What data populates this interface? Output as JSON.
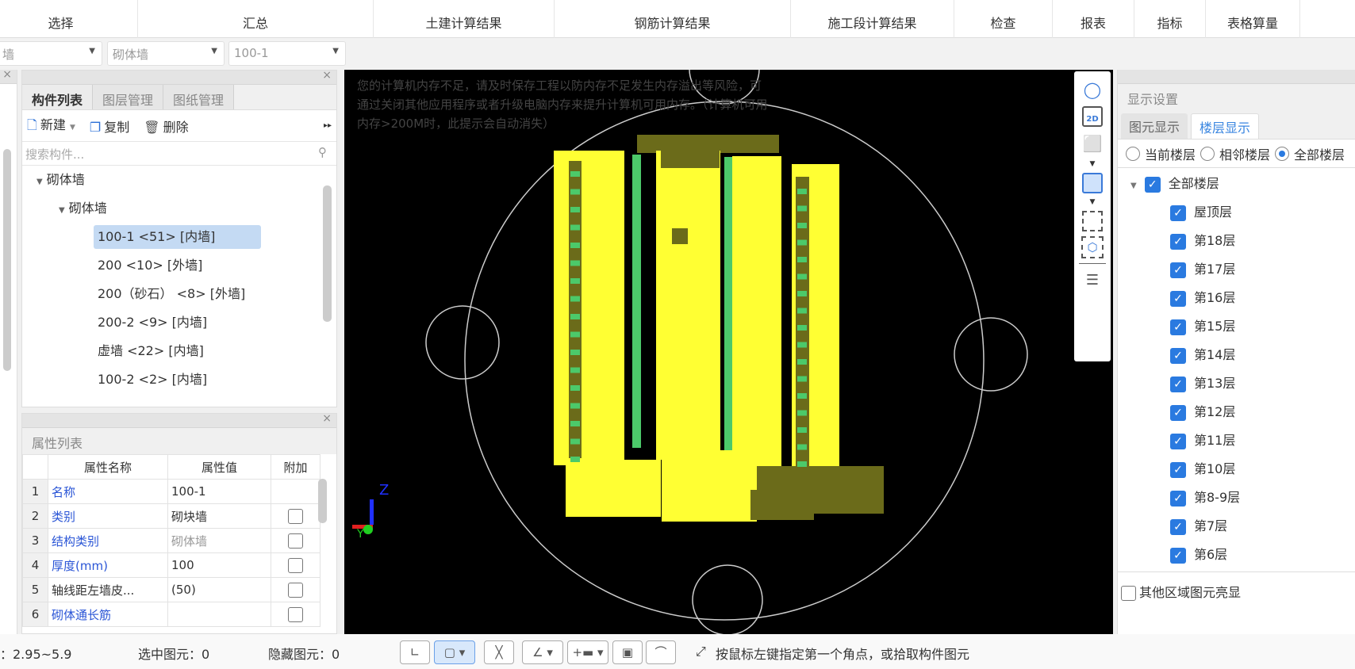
{
  "ribbon": {
    "tabs": [
      "选择",
      "汇总",
      "土建计算结果",
      "钢筋计算结果",
      "施工段计算结果",
      "检查",
      "报表",
      "指标",
      "表格算量"
    ]
  },
  "selectors": {
    "type": "墙",
    "category": "砌体墙",
    "component": "100-1"
  },
  "component_panel": {
    "tabs": [
      "构件列表",
      "图层管理",
      "图纸管理"
    ],
    "toolbar": {
      "new": "新建",
      "copy": "复制",
      "delete": "删除"
    },
    "search_placeholder": "搜索构件...",
    "tree": {
      "root": "砌体墙",
      "group": "砌体墙",
      "items": [
        "100-1 <51> [内墙]",
        "200 <10> [外墙]",
        "200（砂石） <8> [外墙]",
        "200-2 <9> [内墙]",
        "虚墙 <22> [内墙]",
        "100-2 <2> [内墙]"
      ],
      "selected_index": 0
    }
  },
  "property_panel": {
    "title": "属性列表",
    "columns": [
      "属性名称",
      "属性值",
      "附加"
    ],
    "rows": [
      {
        "no": "1",
        "name": "名称",
        "value": "100-1",
        "attach": null
      },
      {
        "no": "2",
        "name": "类别",
        "value": "砌块墙",
        "attach": false
      },
      {
        "no": "3",
        "name": "结构类别",
        "value": "砌体墙",
        "attach": false
      },
      {
        "no": "4",
        "name": "厚度(mm)",
        "value": "100",
        "attach": false
      },
      {
        "no": "5",
        "name": "轴线距左墙皮...",
        "value": "(50)",
        "attach": false
      },
      {
        "no": "6",
        "name": "砌体通长筋",
        "value": "",
        "attach": false
      }
    ]
  },
  "viewport": {
    "warning": "您的计算机内存不足，请及时保存工程以防内存不足发生内存溢出等风险，可通过关闭其他应用程序或者升级电脑内存来提升计算机可用内存。（计算机可用内存>200M时，此提示会自动消失）",
    "axes": {
      "x": "X",
      "y": "Y",
      "z": "Z"
    },
    "colors": {
      "wall": "#ffff33",
      "shadow": "#6b6b1a",
      "green": "#4cc96a"
    }
  },
  "view_toolbar": {
    "icons": [
      "orbit-icon",
      "2d-view-icon",
      "3d-box-icon",
      "3d-solid-icon",
      "fit-view-icon",
      "local-3d-icon",
      "display-list-icon"
    ],
    "label_2d": "2D"
  },
  "display_panel": {
    "title": "显示设置",
    "tabs": [
      "图元显示",
      "楼层显示"
    ],
    "active_tab": 1,
    "radios": [
      "当前楼层",
      "相邻楼层",
      "全部楼层"
    ],
    "radio_selected": 2,
    "floor_root": "全部楼层",
    "floors": [
      "屋顶层",
      "第18层",
      "第17层",
      "第16层",
      "第15层",
      "第14层",
      "第13层",
      "第12层",
      "第11层",
      "第10层",
      "第8-9层",
      "第7层",
      "第6层"
    ],
    "highlight_other": "其他区域图元亮显"
  },
  "status": {
    "elevation": "：2.95~5.9",
    "selected": "选中图元：0",
    "hidden": "隐藏图元：0",
    "prompt": "按鼠标左键指定第一个角点，或拾取构件图元"
  }
}
